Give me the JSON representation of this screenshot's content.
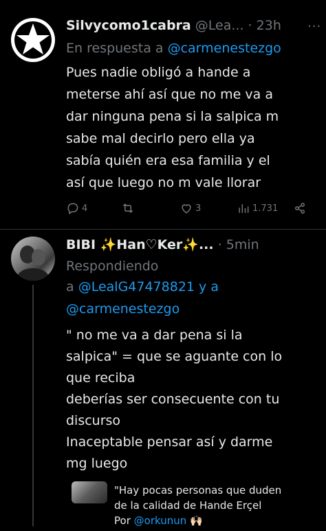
{
  "tweet1": {
    "display_name": "Silvycomo1cabra",
    "handle": "@Lea...",
    "separator": "·",
    "time": "23h",
    "reply_prefix": "En respuesta a",
    "reply_to": "@carmenestezgo",
    "lines": [
      "Pues nadie obligó a hande a",
      "meterse ahí así que no me va a",
      "dar ninguna pena si la salpica m",
      "sabe mal decirlo pero ella ya",
      "sabía quién era esa familia y el",
      "así que luego no m vale llorar"
    ],
    "actions": {
      "replies": "4",
      "retweets": "",
      "likes": "3",
      "views": "1.731"
    }
  },
  "tweet2": {
    "display_name": "BIBI ✨Han♡Ker✨...",
    "separator": "·",
    "time": "5min",
    "reply_prefix_line1": "Respondiendo",
    "reply_a": "a",
    "reply_to_1": "@LealG47478821",
    "reply_y_a": "y a",
    "reply_to_2": "@carmenestezgo",
    "lines": [
      "\" no me va a dar pena si la",
      "salpica\" =  que se aguante con lo",
      "que reciba",
      "deberías ser consecuente con tu",
      "discurso",
      "Inaceptable pensar así y darme",
      "mg luego"
    ]
  },
  "quote_preview": {
    "line1": "\"Hay pocas personas que duden",
    "line2": "de la calidad de Hande Erçel",
    "line3_prefix": "Por",
    "line3_handle": "@orkunun",
    "line3_emoji": "🙌🏻"
  },
  "colors": {
    "background": "#000000",
    "text": "#e7e9ea",
    "muted": "#71767b",
    "link": "#1d9bf0",
    "divider": "#2f3336"
  }
}
